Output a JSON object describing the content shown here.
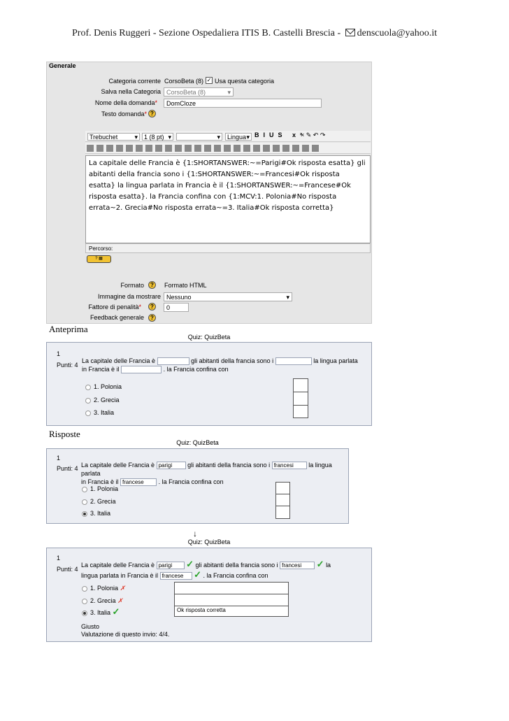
{
  "header": {
    "text": "Prof. Denis Ruggeri - Sezione Ospedaliera ITIS B. Castelli Brescia - ",
    "email": "denscuola@yahoo.it"
  },
  "editor": {
    "section_title": "Generale",
    "categoria_label": "Categoria corrente",
    "categoria_value": "CorsoBeta (8)",
    "usa_categoria": "Usa questa categoria",
    "salva_label": "Salva nella Categoria",
    "salva_value": "CorsoBeta (8)",
    "nome_label": "Nome della domanda",
    "nome_value": "DomCloze",
    "testo_label": "Testo domanda",
    "font_value": "Trebuchet",
    "size_value": "1 (8 pt)",
    "lang_value": "Lingua",
    "question_text": "La capitale delle Francia è {1:SHORTANSWER:~=Parigi#Ok risposta esatta} gli abitanti della francia sono i {1:SHORTANSWER:~=Francesi#Ok risposta esatta} la lingua parlata in Francia è il {1:SHORTANSWER:~=Francese#Ok risposta esatta}. la Francia confina con {1:MCV:1. Polonia#No risposta errata~2. Grecia#No risposta errata~=3. Italia#Ok risposta corretta}",
    "percorso_label": "Percorso:",
    "formato_label": "Formato",
    "formato_value": "Formato HTML",
    "immagine_label": "Immagine da mostrare",
    "immagine_value": "Nessuno",
    "penalita_label": "Fattore di penalità",
    "penalita_value": "0",
    "feedback_label": "Feedback generale"
  },
  "sections": {
    "anteprima": "Anteprima",
    "risposte": "Risposte"
  },
  "quiz": {
    "title": "Quiz: QuizBeta",
    "number": "1",
    "points": "Punti: 4",
    "t1": "La capitale delle Francia è",
    "t2": "gli abitanti della francia sono i",
    "t3": "la lingua parlata",
    "t4": "in Francia è il",
    "t5": ". la Francia confina con",
    "opt1": "1. Polonia",
    "opt2": "2. Grecia",
    "opt3": "3. Italia",
    "ans1": "parigi",
    "ans2": "francesi",
    "ans3": "francese",
    "t3b": "la",
    "t4b": "lingua parlata in Francia è il",
    "feedback": "Ok risposta corretta",
    "result1": "Giusto",
    "result2": "Valutazione di questo invio: 4/4."
  }
}
